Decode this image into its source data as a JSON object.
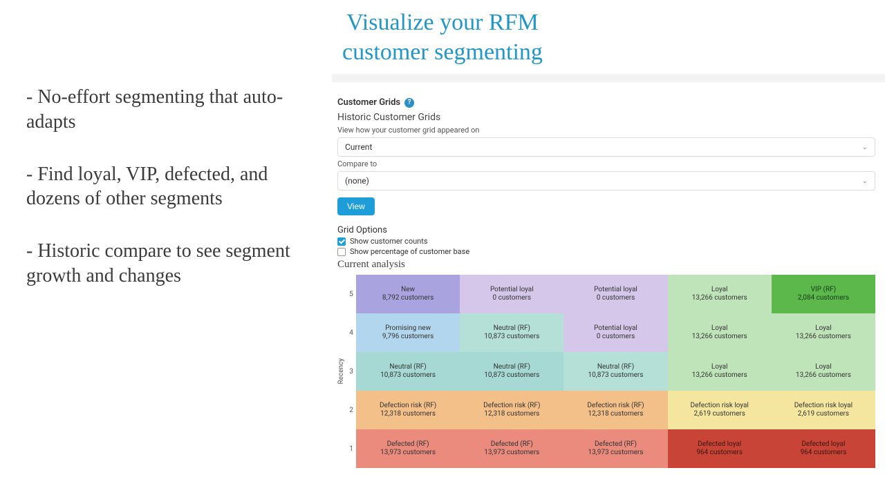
{
  "headline_line1": "Visualize your RFM",
  "headline_line2": "customer segmenting",
  "bullets": [
    "- No-effort segmenting that auto-adapts",
    "- Find loyal, VIP, defected, and dozens of other segments",
    "- Historic compare to see segment growth and changes"
  ],
  "app": {
    "section_title": "Customer Grids",
    "help_glyph": "?",
    "historic_title": "Historic Customer Grids",
    "historic_desc": "View how your customer grid appeared on",
    "date_select_value": "Current",
    "compare_label": "Compare to",
    "compare_select_value": "(none)",
    "view_btn": "View",
    "grid_options_title": "Grid Options",
    "opt_counts_label": "Show customer counts",
    "opt_pct_label": "Show percentage of customer base",
    "analysis_title": "Current analysis",
    "y_axis_label": "Recency",
    "y_ticks": [
      "5",
      "4",
      "3",
      "2",
      "1"
    ]
  },
  "grid_cells": [
    [
      {
        "name": "New",
        "count": "8,792 customers",
        "cls": "c-purple"
      },
      {
        "name": "Potential loyal",
        "count": "0 customers",
        "cls": "c-lav"
      },
      {
        "name": "Potential loyal",
        "count": "0 customers",
        "cls": "c-lav"
      },
      {
        "name": "Loyal",
        "count": "13,266 customers",
        "cls": "c-ltgreen"
      },
      {
        "name": "VIP (RF)",
        "count": "2,084 customers",
        "cls": "c-green"
      }
    ],
    [
      {
        "name": "Promising new",
        "count": "9,796 customers",
        "cls": "c-ltblue"
      },
      {
        "name": "Neutral (RF)",
        "count": "10,873 customers",
        "cls": "c-teal"
      },
      {
        "name": "Potential loyal",
        "count": "0 customers",
        "cls": "c-lav"
      },
      {
        "name": "Loyal",
        "count": "13,266 customers",
        "cls": "c-ltgreen"
      },
      {
        "name": "Loyal",
        "count": "13,266 customers",
        "cls": "c-ltgreen"
      }
    ],
    [
      {
        "name": "Neutral (RF)",
        "count": "10,873 customers",
        "cls": "c-cyan"
      },
      {
        "name": "Neutral (RF)",
        "count": "10,873 customers",
        "cls": "c-cyan"
      },
      {
        "name": "Neutral (RF)",
        "count": "10,873 customers",
        "cls": "c-teal"
      },
      {
        "name": "Loyal",
        "count": "13,266 customers",
        "cls": "c-ltgreen"
      },
      {
        "name": "Loyal",
        "count": "13,266 customers",
        "cls": "c-ltgreen"
      }
    ],
    [
      {
        "name": "Defection risk (RF)",
        "count": "12,318 customers",
        "cls": "c-orange"
      },
      {
        "name": "Defection risk (RF)",
        "count": "12,318 customers",
        "cls": "c-orange"
      },
      {
        "name": "Defection risk (RF)",
        "count": "12,318 customers",
        "cls": "c-orange"
      },
      {
        "name": "Defection risk loyal",
        "count": "2,619 customers",
        "cls": "c-ltyellow"
      },
      {
        "name": "Defection risk loyal",
        "count": "2,619 customers",
        "cls": "c-ltyellow"
      }
    ],
    [
      {
        "name": "Defected (RF)",
        "count": "13,973 customers",
        "cls": "c-red"
      },
      {
        "name": "Defected (RF)",
        "count": "13,973 customers",
        "cls": "c-red"
      },
      {
        "name": "Defected (RF)",
        "count": "13,973 customers",
        "cls": "c-red"
      },
      {
        "name": "Defected loyal",
        "count": "964 customers",
        "cls": "c-darkred"
      },
      {
        "name": "Defected loyal",
        "count": "964 customers",
        "cls": "c-darkred"
      }
    ]
  ]
}
